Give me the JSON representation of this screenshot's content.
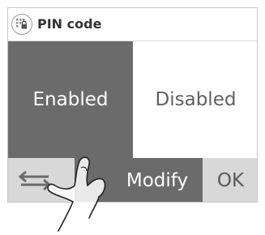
{
  "header": {
    "title": "PIN code",
    "icon": "keypad-lock-icon"
  },
  "options": {
    "enabled_label": "Enabled",
    "disabled_label": "Disabled",
    "selected": "Enabled"
  },
  "bottom_bar": {
    "back_icon": "swap-arrows-icon",
    "modify_label": "Modify",
    "ok_label": "OK"
  },
  "colors": {
    "selected_bg": "#6b6b6b",
    "button_bg": "#d8d8d8",
    "background": "#ffffff"
  }
}
